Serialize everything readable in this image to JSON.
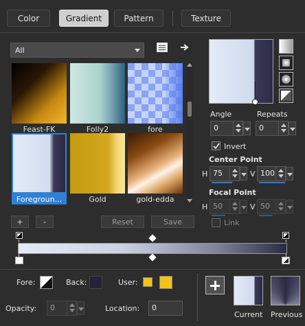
{
  "tabs": [
    {
      "label": "Color"
    },
    {
      "label": "Gradient"
    },
    {
      "label": "Pattern"
    },
    {
      "label": "Texture"
    }
  ],
  "category": {
    "selected": "All"
  },
  "thumbnails": [
    {
      "label": "Feast-FK"
    },
    {
      "label": "Folly2"
    },
    {
      "label": "fore"
    },
    {
      "label": "Foregroun..."
    },
    {
      "label": "Gold"
    },
    {
      "label": "gold-edda"
    }
  ],
  "library_buttons": {
    "add": "+",
    "remove": "-",
    "reset": "Reset",
    "save": "Save"
  },
  "angle": {
    "label": "Angle",
    "value": "0"
  },
  "repeats": {
    "label": "Repeats",
    "value": "0"
  },
  "invert": {
    "label": "Invert",
    "checked": true
  },
  "center_point": {
    "label": "Center Point",
    "h_label": "H",
    "h_value": "75",
    "v_label": "V",
    "v_value": "100"
  },
  "focal_point": {
    "label": "Focal Point",
    "h_label": "H",
    "h_value": "50",
    "v_label": "V",
    "v_value": "50"
  },
  "link": {
    "label": "Link"
  },
  "bottom": {
    "fore_label": "Fore:",
    "back_label": "Back:",
    "user_label": "User:",
    "opacity_label": "Opacity:",
    "opacity_value": "0",
    "location_label": "Location:",
    "location_value": "0",
    "current_label": "Current",
    "previous_label": "Previous"
  },
  "colors": {
    "accent": "#2f80d6",
    "user_swatch": "#f2c31b",
    "gradient_light": "#dfe6f5",
    "gradient_dark": "#2c2a45"
  }
}
